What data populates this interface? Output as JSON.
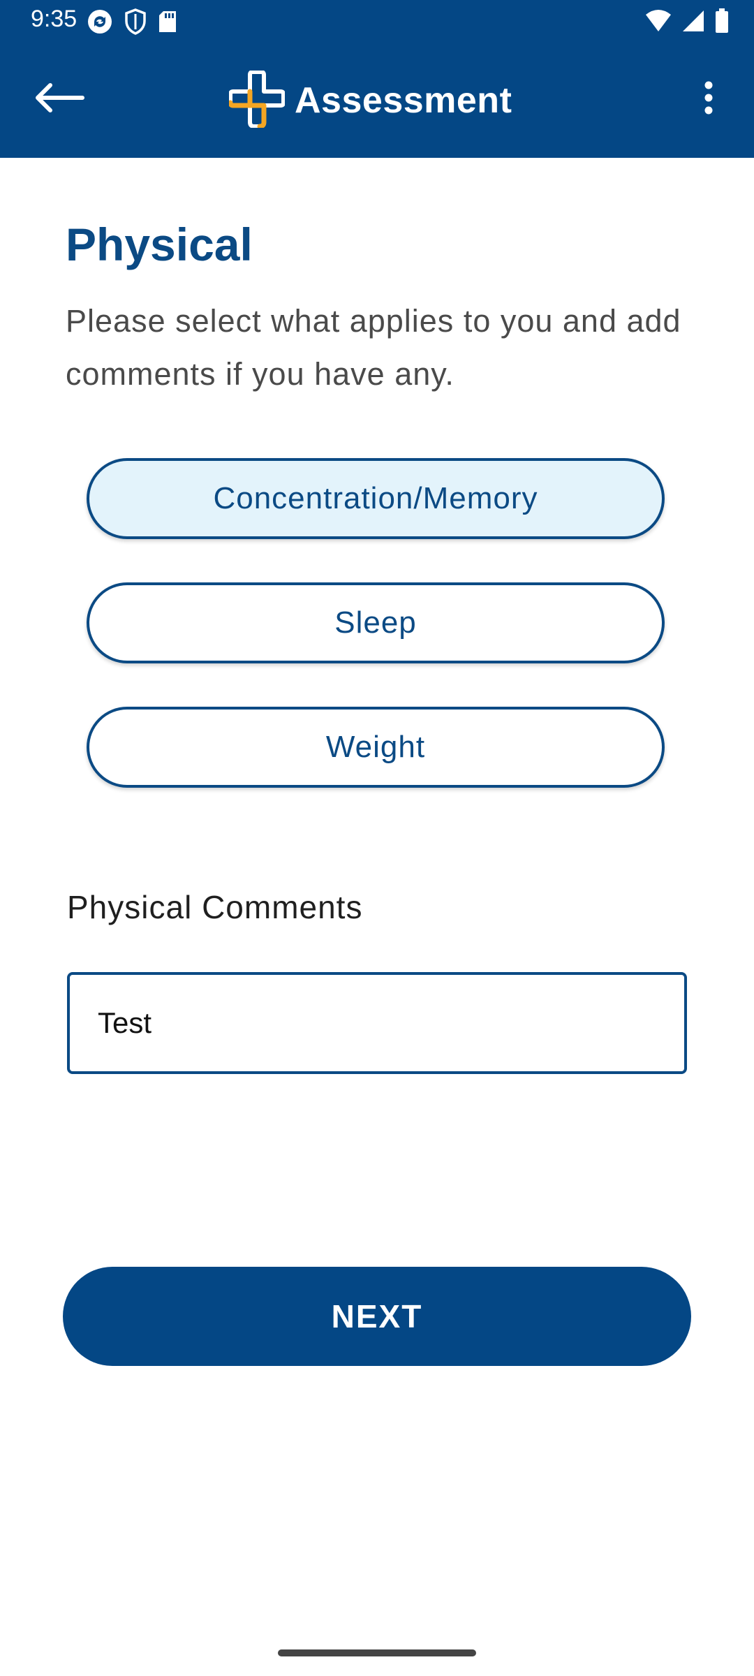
{
  "status_bar": {
    "time": "9:35",
    "icons_left": [
      "sync-icon",
      "shield-icon",
      "sd-card-icon"
    ],
    "icons_right": [
      "wifi-icon",
      "signal-icon",
      "battery-icon"
    ]
  },
  "app_bar": {
    "title": "Assessment",
    "back_icon": "arrow-left-icon",
    "menu_icon": "more-vert-icon",
    "logo_icon": "medical-cross-logo-icon"
  },
  "section": {
    "title": "Physical",
    "instructions": "Please select what applies to you and add comments if you have any."
  },
  "options": [
    {
      "label": "Concentration/Memory",
      "selected": true
    },
    {
      "label": "Sleep",
      "selected": false
    },
    {
      "label": "Weight",
      "selected": false
    }
  ],
  "comments": {
    "label": "Physical Comments",
    "value": "Test"
  },
  "next_button": {
    "label": "NEXT"
  },
  "colors": {
    "primary": "#044785",
    "accent_logo": "#f5a623",
    "selected_bg": "#e3f3fb",
    "text_dark": "#1f1f1f"
  }
}
